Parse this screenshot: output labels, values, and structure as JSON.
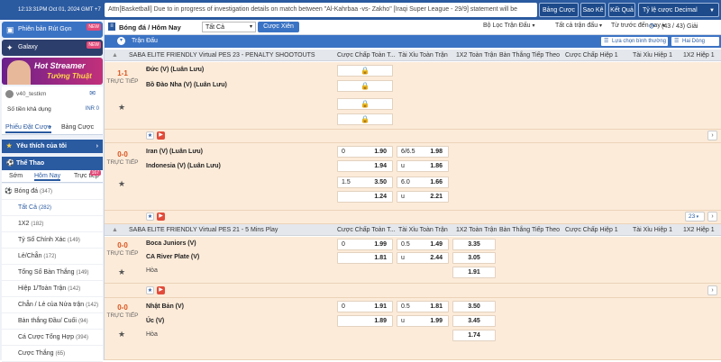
{
  "clock": "12:13:31PM Oct 01, 2024 GMT +7",
  "marquee": "Attn[Basketball] Due to in progress of investigation details on match between \"Al-Kahrbaa -vs- Zakho\" [Iraqi Super League - 29/9] statement will be",
  "top_buttons": [
    "Bảng Cược",
    "Sao Kê",
    "Kết Quả",
    "Tỷ lệ cược Decimal"
  ],
  "sidebar": {
    "promo1": "Phiên bản Rút Gọn",
    "promo1_badge": "NEW",
    "promo2": "Galaxy",
    "promo2_badge": "NEW",
    "banner_line1": "Hot Streamer",
    "banner_line2": "Tường Thuật",
    "username": "v40_testkm",
    "balance_label": "Số tiền khả dụng",
    "balance_value": "INR 0",
    "tabs": [
      "Phiếu Đặt Cược",
      "Bảng Cược"
    ],
    "favorites": "Yêu thích của tôi",
    "sports": "Thể Thao",
    "sport_tabs": [
      "Sớm",
      "Hôm Nay",
      "Trực tiếp"
    ],
    "live_badge": "167",
    "sport": "Bóng đá",
    "sport_count": "(347)",
    "items": [
      {
        "label": "Tất Cả",
        "count": "(282)"
      },
      {
        "label": "1X2",
        "count": "(182)"
      },
      {
        "label": "Tỷ Số Chính Xác",
        "count": "(149)"
      },
      {
        "label": "Lẻ/Chẵn",
        "count": "(172)"
      },
      {
        "label": "Tổng Số Bàn Thắng",
        "count": "(149)"
      },
      {
        "label": "Hiệp 1/Toàn Trận",
        "count": "(142)"
      },
      {
        "label": "Chẵn / Lẻ của Nửa trận",
        "count": "(142)"
      },
      {
        "label": "Bàn thắng Đầu/ Cuối",
        "count": "(94)"
      },
      {
        "label": "Cá Cược Tổng Hợp",
        "count": "(394)"
      },
      {
        "label": "Cược Thắng",
        "count": "(65)"
      }
    ]
  },
  "crumb": {
    "title": "Bóng đá / Hôm Nay",
    "filter": "Tất Cả",
    "combo": "Cược Xiên",
    "league_filter": "Bộ Lọc Trận Đấu",
    "odds_type": "Tất cả trận đấu",
    "sort": "Từ trước đến nay",
    "pages": "(43 / 43) Giải"
  },
  "subbar": {
    "title": "Trận Đấu",
    "option": "Lựa chọn bình thường",
    "columns": "Hai Dòng"
  },
  "headers": [
    "Cược Chấp Toàn T...",
    "Tài Xỉu Toàn Trận",
    "1X2 Toàn Trận",
    "Bàn Thắng Tiếp Theo",
    "Cược Chấp Hiệp 1",
    "Tài Xỉu Hiệp 1",
    "1X2 Hiệp 1"
  ],
  "leagues": [
    {
      "name": "SABA ELITE FRIENDLY Virtual PES 23 - PENALTY SHOOTOUTS"
    },
    {
      "name": "SABA ELITE FRIENDLY Virtual PES 21 - 5 Mins Play"
    }
  ],
  "matches": [
    {
      "score": "1-1",
      "status": "TRỰC TIẾP",
      "home": "Đức (V) (Luân Lưu)",
      "away": "Bồ Đào Nha (V) (Luân Lưu)"
    },
    {
      "score": "0-0",
      "status": "TRỰC TIẾP",
      "home": "Iran (V) (Luân Lưu)",
      "away": "Indonesia (V) (Luân Lưu)",
      "hdp": [
        {
          "h": "0",
          "v": "1.90"
        },
        {
          "h": "",
          "v": "1.94"
        },
        {
          "h": "1.5",
          "v": "3.50"
        },
        {
          "h": "",
          "v": "1.24"
        }
      ],
      "ou": [
        {
          "h": "6/6.5",
          "v": "1.98"
        },
        {
          "h": "u",
          "v": "1.86"
        },
        {
          "h": "6.0",
          "v": "1.66"
        },
        {
          "h": "u",
          "v": "2.21"
        }
      ],
      "more": "23"
    },
    {
      "score": "0-0",
      "status": "TRỰC TIẾP",
      "home": "Boca Juniors (V)",
      "away": "CA River Plate (V)",
      "draw": "Hòa",
      "hdp": [
        {
          "h": "0",
          "v": "1.99"
        },
        {
          "h": "",
          "v": "1.81"
        }
      ],
      "ou": [
        {
          "h": "0.5",
          "v": "1.49"
        },
        {
          "h": "u",
          "v": "2.44"
        }
      ],
      "x12": [
        "3.35",
        "3.05",
        "1.91"
      ]
    },
    {
      "score": "0-0",
      "status": "TRỰC TIẾP",
      "home": "Nhật Bản (V)",
      "away": "Úc (V)",
      "draw": "Hòa",
      "hdp": [
        {
          "h": "0",
          "v": "1.91"
        },
        {
          "h": "",
          "v": "1.89"
        }
      ],
      "ou": [
        {
          "h": "0.5",
          "v": "1.81"
        },
        {
          "h": "u",
          "v": "1.99"
        }
      ],
      "x12": [
        "3.50",
        "3.45",
        "1.74"
      ]
    }
  ],
  "colors": {
    "brand": "#2a5aa0",
    "accent": "#3b73c4",
    "score": "#d9531e",
    "row": "#fcebd9"
  }
}
